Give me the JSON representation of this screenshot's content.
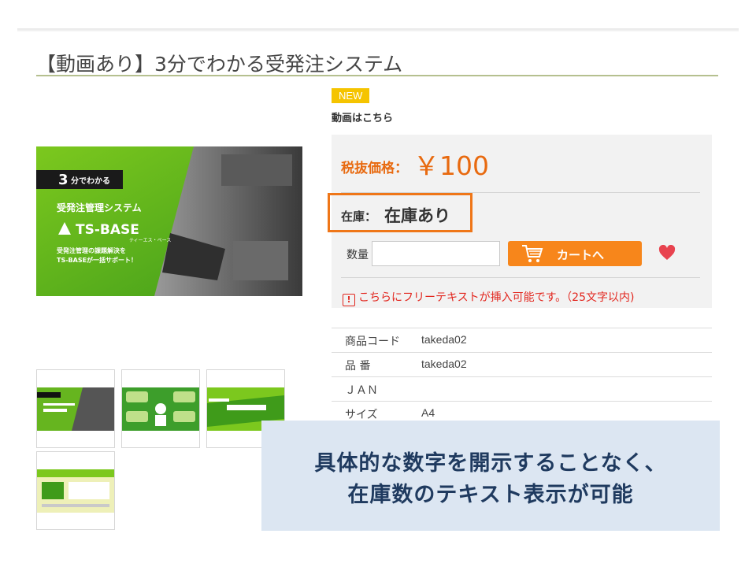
{
  "page": {
    "title": "【動画あり】3分でわかる受発注システム"
  },
  "gallery": {
    "main_image": {
      "badge_num": "3",
      "badge_text": "分でわかる",
      "headline": "受発注管理システム",
      "logo": "TS-BASE",
      "logo_sub": "ティーエス・ベース",
      "line1": "受発注管理の課題解決を",
      "line2": "TS-BASEが一括サポート！"
    },
    "thumbs": [
      "thumb-1",
      "thumb-2",
      "thumb-3",
      "thumb-4"
    ]
  },
  "product": {
    "badge": "NEW",
    "video_link": "動画はこちら",
    "price_label": "税抜価格：",
    "price": "￥100",
    "stock_label": "在庫：",
    "stock_value": "在庫あり",
    "qty_label": "数量",
    "qty_value": "",
    "cart_label": "カートへ",
    "notice": "こちらにフリーテキストが挿入可能です。（25文字以内)",
    "colors": {
      "accent": "#f7861b",
      "price": "#e86a10",
      "notice": "#e2261e",
      "heart": "#e8434f"
    }
  },
  "specs": [
    {
      "key": "商品コード",
      "value": "takeda02"
    },
    {
      "key": "品 番",
      "value": "takeda02"
    },
    {
      "key": "ＪＡＮ",
      "value": ""
    },
    {
      "key": "サイズ",
      "value": "A4"
    }
  ],
  "overlay": {
    "line1": "具体的な数字を開示することなく、",
    "line2": "在庫数のテキスト表示が可能"
  }
}
